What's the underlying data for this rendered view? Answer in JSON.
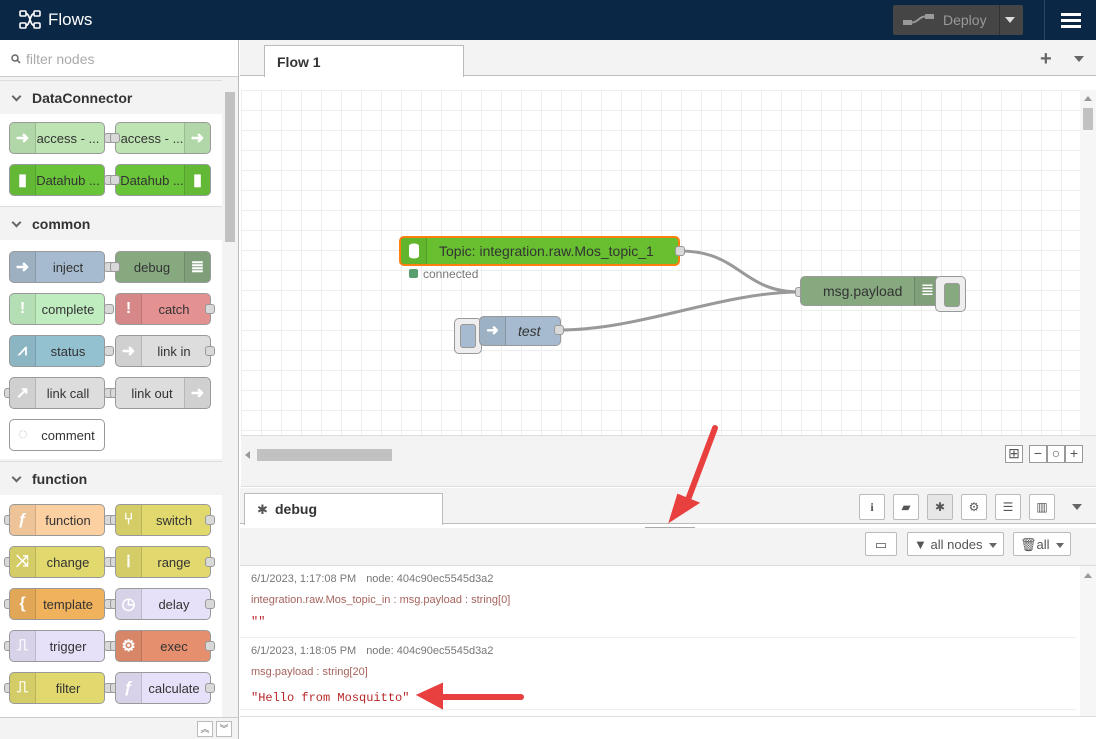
{
  "header": {
    "title": "Flows",
    "deploy_label": "Deploy"
  },
  "palette": {
    "filter_placeholder": "filter nodes",
    "categories": [
      {
        "name": "DataConnector",
        "nodes": [
          "access - ...",
          "access - ...",
          "Datahub ...",
          "Datahub ..."
        ]
      },
      {
        "name": "common",
        "nodes": [
          "inject",
          "debug",
          "complete",
          "catch",
          "status",
          "link in",
          "link call",
          "link out",
          "comment"
        ]
      },
      {
        "name": "function",
        "nodes": [
          "function",
          "switch",
          "change",
          "range",
          "template",
          "delay",
          "trigger",
          "exec",
          "filter",
          "calculate"
        ]
      }
    ]
  },
  "workspace": {
    "tab": "Flow 1",
    "nodes": {
      "subscriber": {
        "label": "Topic: integration.raw.Mos_topic_1",
        "status": "connected",
        "status_color": "#5a9f6e"
      },
      "inject": {
        "label": "test"
      },
      "debug": {
        "label": "msg.payload"
      }
    }
  },
  "sidebar": {
    "tab": "debug",
    "filter_label": "all nodes",
    "clear_label": "all",
    "messages": [
      {
        "time": "6/1/2023, 1:17:08 PM",
        "node": "node: 404c90ec5545d3a2",
        "topic": "integration.raw.Mos_topic_in : msg.payload : string[0]",
        "value": "\"\""
      },
      {
        "time": "6/1/2023, 1:18:05 PM",
        "node": "node: 404c90ec5545d3a2",
        "topic": "msg.payload : string[20]",
        "value": "\"Hello from Mosquitto\""
      }
    ]
  },
  "colors": {
    "header": "#0a2745",
    "connector": "#68c031",
    "inject": "#a6bbcf",
    "debug": "#87a980",
    "annotation_arrow": "#e8403f"
  }
}
